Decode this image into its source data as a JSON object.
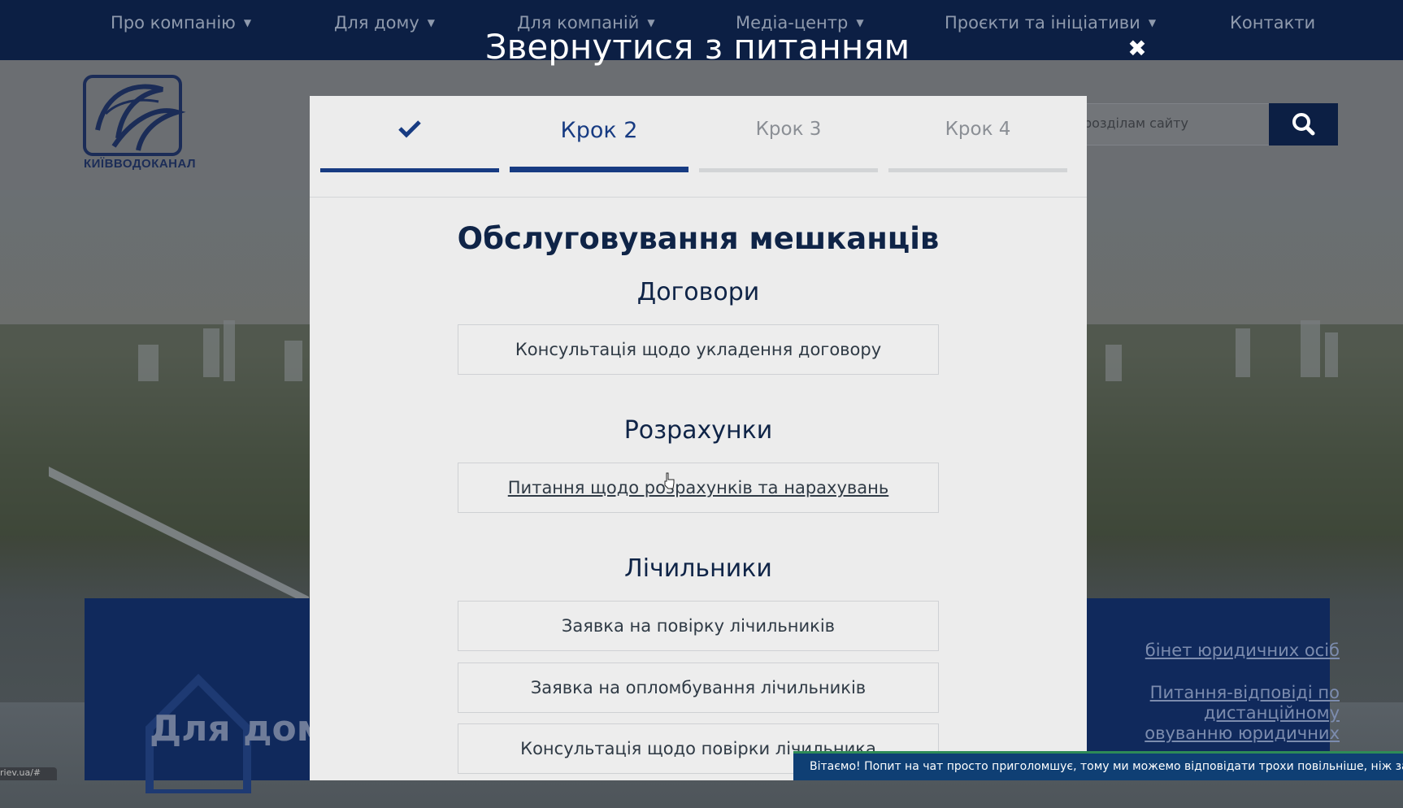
{
  "nav": {
    "items": [
      {
        "label": "Про компанію",
        "has_dropdown": true
      },
      {
        "label": "Для дому",
        "has_dropdown": true
      },
      {
        "label": "Для компаній",
        "has_dropdown": true
      },
      {
        "label": "Медіа-центр",
        "has_dropdown": true
      },
      {
        "label": "Проєкти та ініціативи",
        "has_dropdown": true
      },
      {
        "label": "Контакти",
        "has_dropdown": false
      }
    ]
  },
  "header": {
    "logo_text": "КИЇВВОДОКАНАЛ",
    "search_placeholder": "розділам сайту",
    "search_icon": "search-icon"
  },
  "hero": {
    "left_panel_title": "Для дому",
    "right_links": [
      "бінет юридичних осіб",
      "Питання-відповіді по",
      "дистанційному",
      "овуванню юридичних"
    ]
  },
  "status_url": "riev.ua/#",
  "modal": {
    "title": "Звернутися з питанням",
    "close_icon": "close-icon",
    "steps": [
      {
        "label": "",
        "state": "done",
        "icon": "checkmark-icon"
      },
      {
        "label": "Крок 2",
        "state": "active"
      },
      {
        "label": "Крок 3",
        "state": "pending"
      },
      {
        "label": "Крок 4",
        "state": "pending"
      }
    ],
    "heading": "Обслуговування мешканців",
    "sections": [
      {
        "title": "Договори",
        "options": [
          "Консультація щодо укладення договору"
        ]
      },
      {
        "title": "Розрахунки",
        "options": [
          "Питання щодо розрахунків та нарахувань"
        ]
      },
      {
        "title": "Лічильники",
        "options": [
          "Заявка на повірку лічильників",
          "Заявка на опломбування лічильників",
          "Консультація щодо повірки лічильника"
        ]
      }
    ]
  },
  "chat": {
    "message": "Вітаємо! Попит на чат просто приголомшує, тому ми можемо відповідати трохи повільніше, ніж зазвичай"
  },
  "colors": {
    "navy": "#0c1f44",
    "accent": "#173b82",
    "modal_bg": "#ececec",
    "chat_bg": "#0f3f74",
    "chat_border": "#2e8b57"
  }
}
